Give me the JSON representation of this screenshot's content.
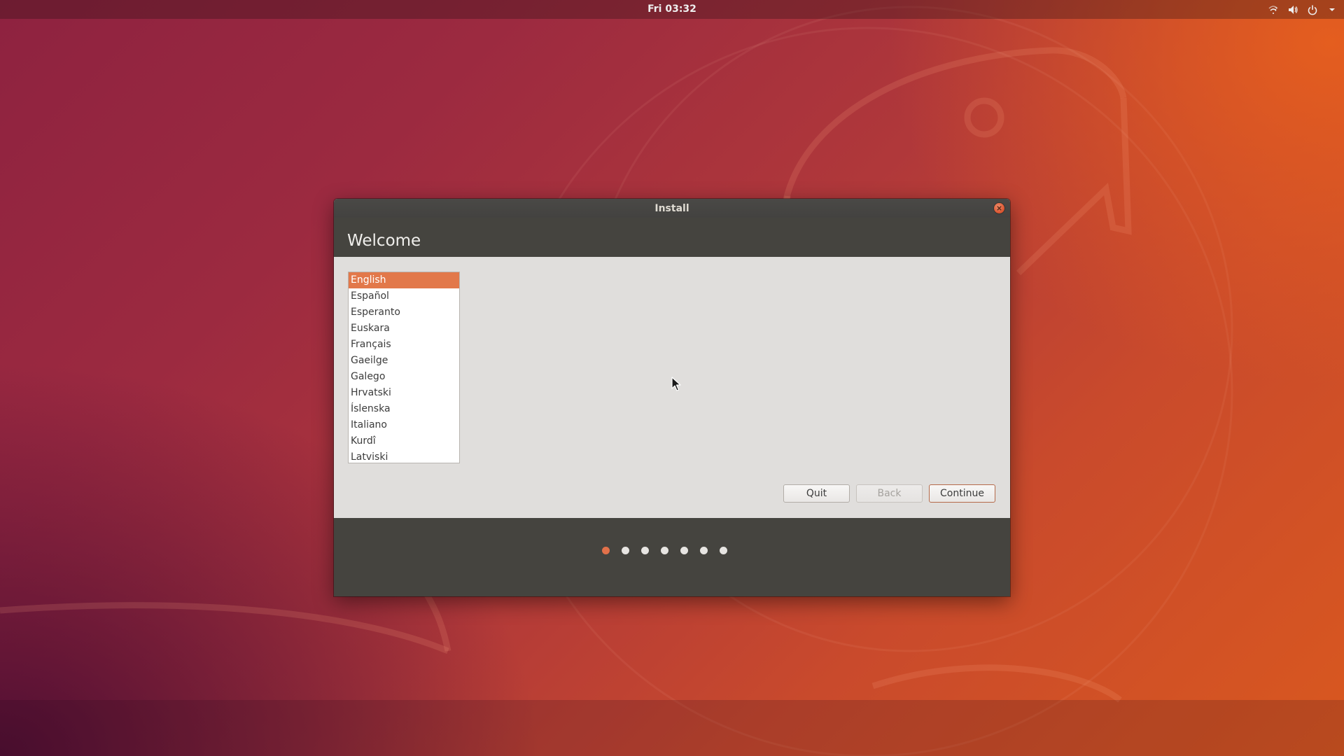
{
  "top_bar": {
    "clock": "Fri 03:32",
    "tray_icons": [
      "network-icon",
      "volume-icon",
      "power-icon",
      "chevron-down-icon"
    ]
  },
  "window": {
    "title": "Install",
    "header_title": "Welcome",
    "languages": [
      "English",
      "Español",
      "Esperanto",
      "Euskara",
      "Français",
      "Gaeilge",
      "Galego",
      "Hrvatski",
      "Íslenska",
      "Italiano",
      "Kurdî",
      "Latviski"
    ],
    "selected_language": "English",
    "buttons": {
      "quit": "Quit",
      "back": "Back",
      "continue": "Continue"
    },
    "steps": {
      "total": 7,
      "current": 1
    }
  },
  "colors": {
    "accent": "#e2784a",
    "header_bg": "#45443f",
    "content_bg": "#e0dedc"
  }
}
